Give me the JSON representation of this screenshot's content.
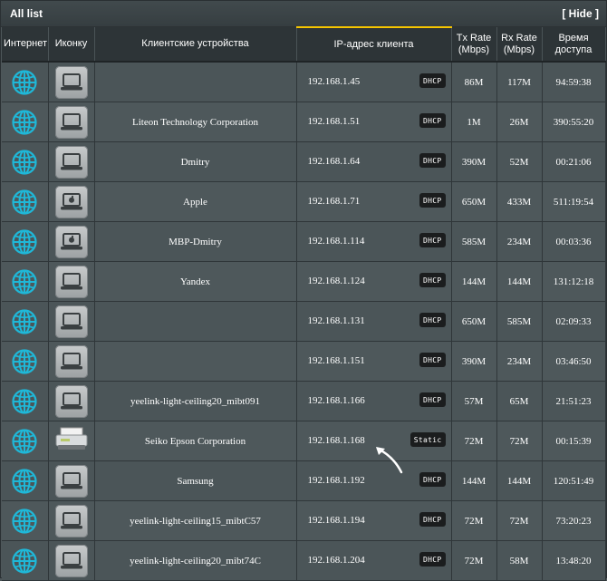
{
  "header": {
    "title": "All list",
    "hide_label": "[ Hide ]"
  },
  "columns": {
    "internet": "Интернет",
    "icon": "Иконку",
    "device": "Клиентские устройства",
    "ip": "IP-адрес клиента",
    "tx": "Tx Rate (Mbps)",
    "rx": "Rx Rate (Mbps)",
    "time": "Время доступа"
  },
  "accent_color": "#f5c500",
  "internet_icon": "globe-icon",
  "rows": [
    {
      "name": "",
      "icon": "laptop-icon",
      "ip": "192.168.1.45",
      "type": "DHCP",
      "tx": "86M",
      "rx": "117M",
      "time": "94:59:38"
    },
    {
      "name": "Liteon Technology Corporation",
      "icon": "laptop-icon",
      "ip": "192.168.1.51",
      "type": "DHCP",
      "tx": "1M",
      "rx": "26M",
      "time": "390:55:20"
    },
    {
      "name": "Dmitry",
      "icon": "laptop-icon",
      "ip": "192.168.1.64",
      "type": "DHCP",
      "tx": "390M",
      "rx": "52M",
      "time": "00:21:06"
    },
    {
      "name": "Apple",
      "icon": "apple-laptop-icon",
      "ip": "192.168.1.71",
      "type": "DHCP",
      "tx": "650M",
      "rx": "433M",
      "time": "511:19:54"
    },
    {
      "name": "MBP-Dmitry",
      "icon": "apple-laptop-icon",
      "ip": "192.168.1.114",
      "type": "DHCP",
      "tx": "585M",
      "rx": "234M",
      "time": "00:03:36"
    },
    {
      "name": "Yandex",
      "icon": "laptop-icon",
      "ip": "192.168.1.124",
      "type": "DHCP",
      "tx": "144M",
      "rx": "144M",
      "time": "131:12:18"
    },
    {
      "name": "",
      "icon": "laptop-icon",
      "ip": "192.168.1.131",
      "type": "DHCP",
      "tx": "650M",
      "rx": "585M",
      "time": "02:09:33"
    },
    {
      "name": "",
      "icon": "laptop-icon",
      "ip": "192.168.1.151",
      "type": "DHCP",
      "tx": "390M",
      "rx": "234M",
      "time": "03:46:50"
    },
    {
      "name": "yeelink-light-ceiling20_mibt091",
      "icon": "laptop-icon",
      "ip": "192.168.1.166",
      "type": "DHCP",
      "tx": "57M",
      "rx": "65M",
      "time": "21:51:23"
    },
    {
      "name": "Seiko Epson Corporation",
      "icon": "printer-icon",
      "ip": "192.168.1.168",
      "type": "Static",
      "tx": "72M",
      "rx": "72M",
      "time": "00:15:39"
    },
    {
      "name": "Samsung",
      "icon": "laptop-icon",
      "ip": "192.168.1.192",
      "type": "DHCP",
      "tx": "144M",
      "rx": "144M",
      "time": "120:51:49"
    },
    {
      "name": "yeelink-light-ceiling15_mibtC57",
      "icon": "laptop-icon",
      "ip": "192.168.1.194",
      "type": "DHCP",
      "tx": "72M",
      "rx": "72M",
      "time": "73:20:23"
    },
    {
      "name": "yeelink-light-ceiling20_mibt74C",
      "icon": "laptop-icon",
      "ip": "192.168.1.204",
      "type": "DHCP",
      "tx": "72M",
      "rx": "58M",
      "time": "13:48:20"
    }
  ]
}
